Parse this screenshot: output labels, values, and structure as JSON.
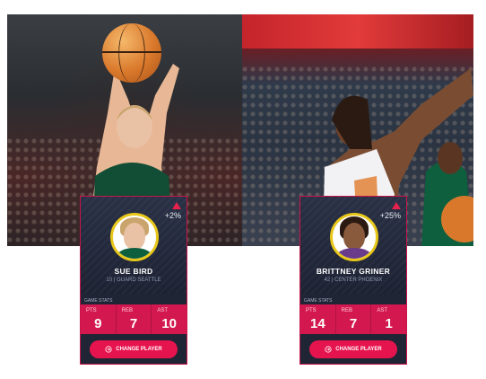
{
  "players": [
    {
      "name": "SUE BIRD",
      "subtitle": "10 | GUARD SEATTLE",
      "trend": "+2%",
      "stats_label": "GAME STATS",
      "stats": [
        {
          "label": "PTS",
          "value": "9"
        },
        {
          "label": "REB",
          "value": "7"
        },
        {
          "label": "AST",
          "value": "10"
        }
      ],
      "button_label": "CHANGE PLAYER"
    },
    {
      "name": "BRITTNEY GRINER",
      "subtitle": "42 | CENTER PHOENIX",
      "trend": "+25%",
      "stats_label": "GAME STATS",
      "stats": [
        {
          "label": "PTS",
          "value": "14"
        },
        {
          "label": "REB",
          "value": "7"
        },
        {
          "label": "AST",
          "value": "1"
        }
      ],
      "button_label": "CHANGE PLAYER"
    }
  ],
  "icons": {
    "trend": "trend-up-icon",
    "button": "swap-circle-icon"
  },
  "colors": {
    "accent": "#e6144e",
    "card_bg": "#1f2535",
    "avatar_ring": "#e8c71a"
  }
}
